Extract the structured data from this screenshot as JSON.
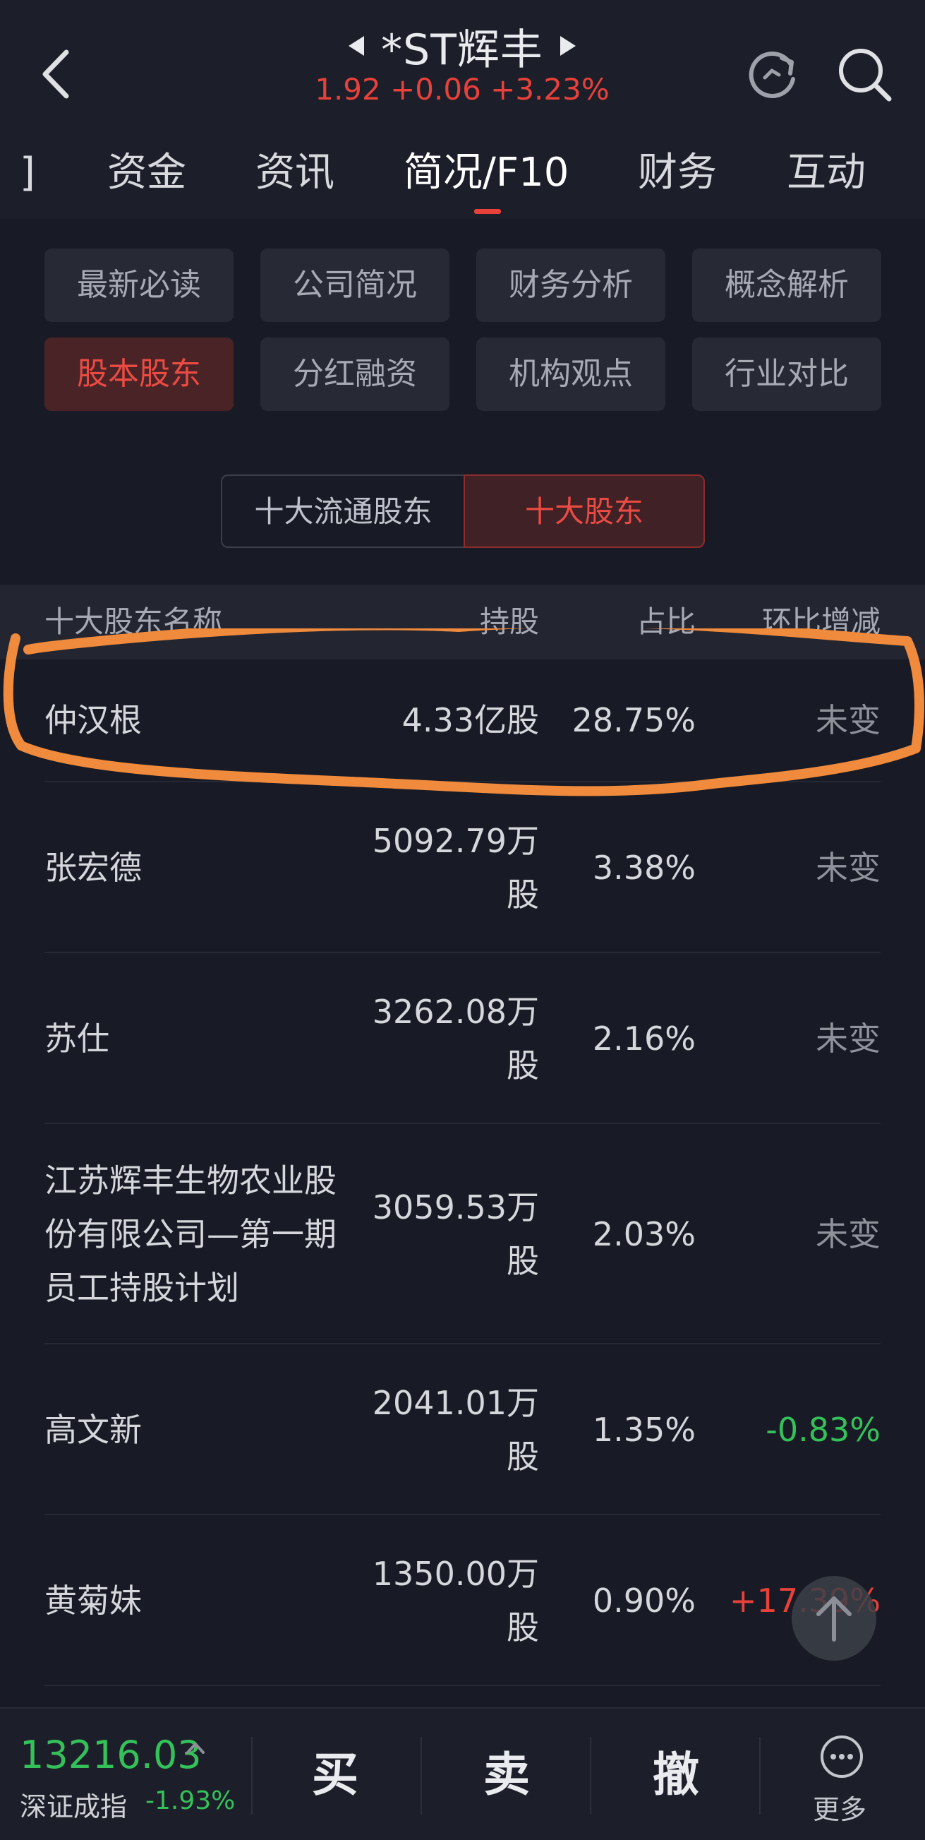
{
  "header": {
    "title": "*ST辉丰",
    "quote": "1.92 +0.06 +3.23%"
  },
  "tabs": [
    {
      "label": "]"
    },
    {
      "label": "资金"
    },
    {
      "label": "资讯"
    },
    {
      "label": "简况/F10"
    },
    {
      "label": "财务"
    },
    {
      "label": "互动"
    }
  ],
  "grid": [
    {
      "label": "最新必读"
    },
    {
      "label": "公司简况"
    },
    {
      "label": "财务分析"
    },
    {
      "label": "概念解析"
    },
    {
      "label": "股本股东"
    },
    {
      "label": "分红融资"
    },
    {
      "label": "机构观点"
    },
    {
      "label": "行业对比"
    }
  ],
  "segment": {
    "left": "十大流通股东",
    "right": "十大股东"
  },
  "table": {
    "headers": {
      "name": "十大股东名称",
      "holding": "持股",
      "ratio": "占比",
      "change": "环比增减"
    },
    "rows": [
      {
        "name": "仲汉根",
        "holding": "4.33亿股",
        "ratio": "28.75%",
        "change": "未变"
      },
      {
        "name": "张宏德",
        "holding": "5092.79万股",
        "ratio": "3.38%",
        "change": "未变"
      },
      {
        "name": "苏仕",
        "holding": "3262.08万股",
        "ratio": "2.16%",
        "change": "未变"
      },
      {
        "name": "江苏辉丰生物农业股份有限公司—第一期员工持股计划",
        "holding": "3059.53万股",
        "ratio": "2.03%",
        "change": "未变"
      },
      {
        "name": "高文新",
        "holding": "2041.01万股",
        "ratio": "1.35%",
        "change": "-0.83%"
      },
      {
        "name": "黄菊妹",
        "holding": "1350.00万股",
        "ratio": "0.90%",
        "change": "+17.39%"
      }
    ]
  },
  "bottom": {
    "index_value": "13216.03",
    "index_name": "深证成指",
    "index_change": "-1.93%",
    "buy": "买",
    "sell": "卖",
    "cancel": "撤",
    "more": "更多"
  },
  "colors": {
    "up": "#e8413a",
    "down": "#35c15a",
    "highlight": "#f08a3c"
  }
}
